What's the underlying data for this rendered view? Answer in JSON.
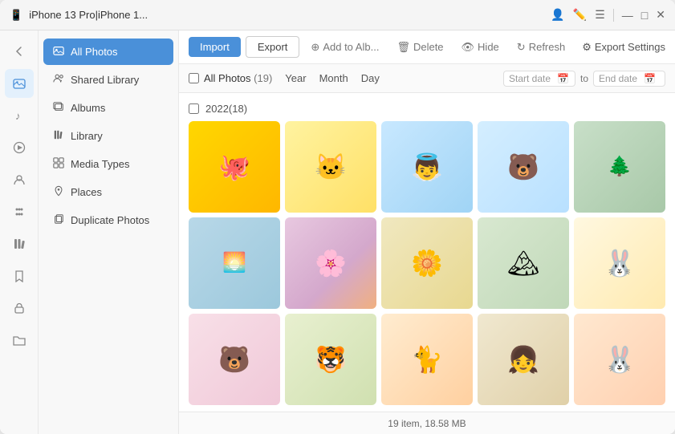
{
  "titleBar": {
    "icon": "📱",
    "title": "iPhone 13 Pro|iPhone 1...",
    "controls": [
      "user-icon",
      "edit-icon",
      "menu-icon",
      "minimize",
      "maximize",
      "close"
    ]
  },
  "iconBar": {
    "items": [
      {
        "name": "back-icon",
        "symbol": "←"
      },
      {
        "name": "photos-icon",
        "symbol": "🖼"
      },
      {
        "name": "music-icon",
        "symbol": "♪"
      },
      {
        "name": "video-icon",
        "symbol": "▶"
      },
      {
        "name": "contact-icon",
        "symbol": "👤"
      },
      {
        "name": "apps-icon",
        "symbol": "❋"
      },
      {
        "name": "books-icon",
        "symbol": "📚"
      },
      {
        "name": "bookmark-icon",
        "symbol": "🔖"
      },
      {
        "name": "lock-icon",
        "symbol": "🔒"
      },
      {
        "name": "folder-icon",
        "symbol": "📁"
      }
    ]
  },
  "sidebar": {
    "items": [
      {
        "label": "All Photos",
        "icon": "🖼",
        "active": true
      },
      {
        "label": "Shared Library",
        "icon": "👥",
        "active": false
      },
      {
        "label": "Albums",
        "icon": "🗂",
        "active": false
      },
      {
        "label": "Library",
        "icon": "📚",
        "active": false
      },
      {
        "label": "Media Types",
        "icon": "⊞",
        "active": false
      },
      {
        "label": "Places",
        "icon": "📍",
        "active": false
      },
      {
        "label": "Duplicate Photos",
        "icon": "📋",
        "active": false
      }
    ]
  },
  "toolbar": {
    "import_label": "Import",
    "export_label": "Export",
    "add_to_album_label": "Add to Alb...",
    "delete_label": "Delete",
    "hide_label": "Hide",
    "refresh_label": "Refresh",
    "export_settings_label": "Export Settings"
  },
  "filterBar": {
    "all_photos_label": "All Photos",
    "count": "(19)",
    "tabs": [
      "Year",
      "Month",
      "Day"
    ],
    "start_date_placeholder": "Start date",
    "end_date_placeholder": "End date",
    "to_label": "to"
  },
  "photoGrid": {
    "year_label": "2022(18)",
    "photos": [
      {
        "id": 1,
        "emoji": "🐙",
        "bg": "photo-1"
      },
      {
        "id": 2,
        "emoji": "🐱",
        "bg": "photo-2"
      },
      {
        "id": 3,
        "emoji": "👼",
        "bg": "photo-3"
      },
      {
        "id": 4,
        "emoji": "🐻",
        "bg": "photo-4"
      },
      {
        "id": 5,
        "emoji": "🌲",
        "bg": "photo-5"
      },
      {
        "id": 6,
        "emoji": "🌅",
        "bg": "photo-6"
      },
      {
        "id": 7,
        "emoji": "🌸",
        "bg": "photo-7"
      },
      {
        "id": 8,
        "emoji": "🌼",
        "bg": "photo-8"
      },
      {
        "id": 9,
        "emoji": "🏔",
        "bg": "photo-9"
      },
      {
        "id": 10,
        "emoji": "🐰",
        "bg": "photo-10"
      },
      {
        "id": 11,
        "emoji": "🐻",
        "bg": "photo-11"
      },
      {
        "id": 12,
        "emoji": "🐯",
        "bg": "photo-12"
      },
      {
        "id": 13,
        "emoji": "🐈",
        "bg": "photo-13"
      },
      {
        "id": 14,
        "emoji": "👧",
        "bg": "photo-14"
      },
      {
        "id": 15,
        "emoji": "🐰",
        "bg": "photo-15"
      }
    ]
  },
  "statusBar": {
    "text": "19 item, 18.58 MB"
  }
}
